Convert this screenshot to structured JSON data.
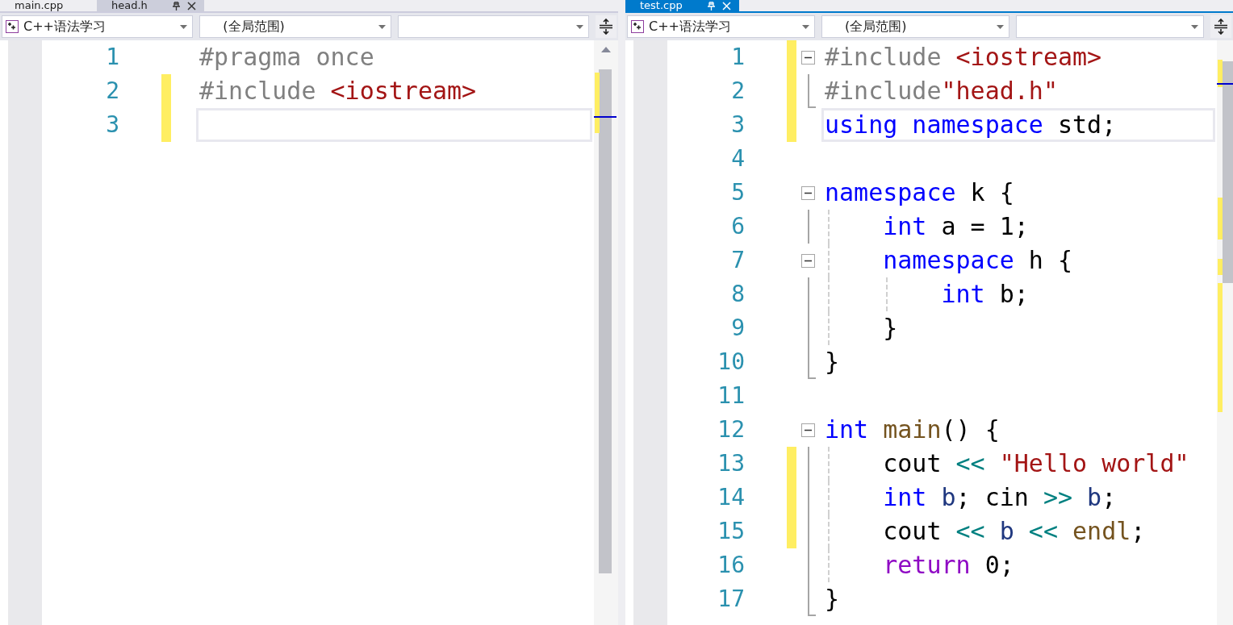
{
  "panes": [
    {
      "focused": false,
      "tabs": [
        {
          "label": "main.cpp",
          "selected": false
        },
        {
          "label": "head.h",
          "selected": true
        }
      ],
      "navigation": {
        "project": "C++语法学习",
        "scope": "(全局范围)"
      },
      "lines": [
        {
          "number": "1",
          "changed": false,
          "current": false,
          "kind": "plain",
          "segments": [
            {
              "text": "#pragma once",
              "kind": "preproc"
            }
          ]
        },
        {
          "number": "2",
          "changed": true,
          "current": false,
          "kind": "plain",
          "segments": [
            {
              "text": "#include ",
              "kind": "preproc"
            },
            {
              "text": "<iostream>",
              "kind": "include"
            }
          ]
        },
        {
          "number": "3",
          "changed": true,
          "current": true,
          "kind": "plain"
        }
      ]
    },
    {
      "focused": true,
      "tabs": [
        {
          "label": "test.cpp",
          "selected": true
        }
      ],
      "navigation": {
        "project": "C++语法学习",
        "scope": "(全局范围)"
      },
      "lines": [
        {
          "number": "1",
          "changed": true,
          "current": false,
          "kind": "fold-start",
          "segments": [
            {
              "text": "#include ",
              "kind": "preproc"
            },
            {
              "text": "<iostream>",
              "kind": "include"
            }
          ]
        },
        {
          "number": "2",
          "changed": true,
          "current": false,
          "kind": "fold-end",
          "segments": [
            {
              "text": "#include",
              "kind": "preproc"
            },
            {
              "text": "\"head.h\"",
              "kind": "include"
            }
          ]
        },
        {
          "number": "3",
          "changed": true,
          "current": true,
          "kind": "plain",
          "segments": [
            {
              "text": "using namespace",
              "kind": "keyword"
            },
            {
              "text": " std;",
              "kind": "plain"
            }
          ]
        },
        {
          "number": "4",
          "changed": false,
          "current": false,
          "kind": "plain"
        },
        {
          "number": "5",
          "changed": false,
          "current": false,
          "kind": "fold-start",
          "segments": [
            {
              "text": "namespace",
              "kind": "keyword"
            },
            {
              "text": " k {",
              "kind": "plain"
            }
          ]
        },
        {
          "number": "6",
          "changed": false,
          "current": false,
          "kind": "fold-inner",
          "segments": [
            {
              "text": "    int",
              "kind": "keyword"
            },
            {
              "text": " a = 1;",
              "kind": "plain"
            }
          ]
        },
        {
          "number": "7",
          "changed": false,
          "current": false,
          "kind": "fold-start",
          "segments": [
            {
              "text": "    namespace",
              "kind": "keyword"
            },
            {
              "text": " h {",
              "kind": "plain"
            }
          ]
        },
        {
          "number": "8",
          "changed": false,
          "current": false,
          "kind": "fold-inner",
          "segments": [
            {
              "text": "        int",
              "kind": "keyword"
            },
            {
              "text": " b;",
              "kind": "plain"
            }
          ]
        },
        {
          "number": "9",
          "changed": false,
          "current": false,
          "kind": "fold-inner",
          "segments": [
            {
              "text": "    }",
              "kind": "plain"
            }
          ]
        },
        {
          "number": "10",
          "changed": false,
          "current": false,
          "kind": "fold-end",
          "segments": [
            {
              "text": "}",
              "kind": "plain"
            }
          ]
        },
        {
          "number": "11",
          "changed": false,
          "current": false,
          "kind": "plain"
        },
        {
          "number": "12",
          "changed": false,
          "current": false,
          "kind": "fold-start",
          "segments": [
            {
              "text": "int",
              "kind": "keyword"
            },
            {
              "text": " main",
              "kind": "function"
            },
            {
              "text": "() {",
              "kind": "plain"
            }
          ]
        },
        {
          "number": "13",
          "changed": true,
          "current": false,
          "kind": "fold-inner",
          "segments": [
            {
              "text": "    cout ",
              "kind": "plain"
            },
            {
              "text": "<<",
              "kind": "operator"
            },
            {
              "text": " \"Hello world\"",
              "kind": "string"
            }
          ]
        },
        {
          "number": "14",
          "changed": true,
          "current": false,
          "kind": "fold-inner",
          "segments": [
            {
              "text": "    int",
              "kind": "keyword"
            },
            {
              "text": " b",
              "kind": "variable"
            },
            {
              "text": "; cin ",
              "kind": "plain"
            },
            {
              "text": ">>",
              "kind": "operator"
            },
            {
              "text": " b",
              "kind": "variable"
            },
            {
              "text": ";",
              "kind": "plain"
            }
          ]
        },
        {
          "number": "15",
          "changed": true,
          "current": false,
          "kind": "fold-inner",
          "segments": [
            {
              "text": "    cout ",
              "kind": "plain"
            },
            {
              "text": "<<",
              "kind": "operator"
            },
            {
              "text": " b",
              "kind": "variable"
            },
            {
              "text": " <<",
              "kind": "operator"
            },
            {
              "text": " endl",
              "kind": "function"
            },
            {
              "text": ";",
              "kind": "plain"
            }
          ]
        },
        {
          "number": "16",
          "changed": false,
          "current": false,
          "kind": "fold-inner",
          "segments": [
            {
              "text": "    return",
              "kind": "control"
            },
            {
              "text": " 0;",
              "kind": "plain"
            }
          ]
        },
        {
          "number": "17",
          "changed": false,
          "current": false,
          "kind": "fold-end",
          "segments": [
            {
              "text": "}",
              "kind": "plain"
            }
          ]
        }
      ]
    }
  ]
}
